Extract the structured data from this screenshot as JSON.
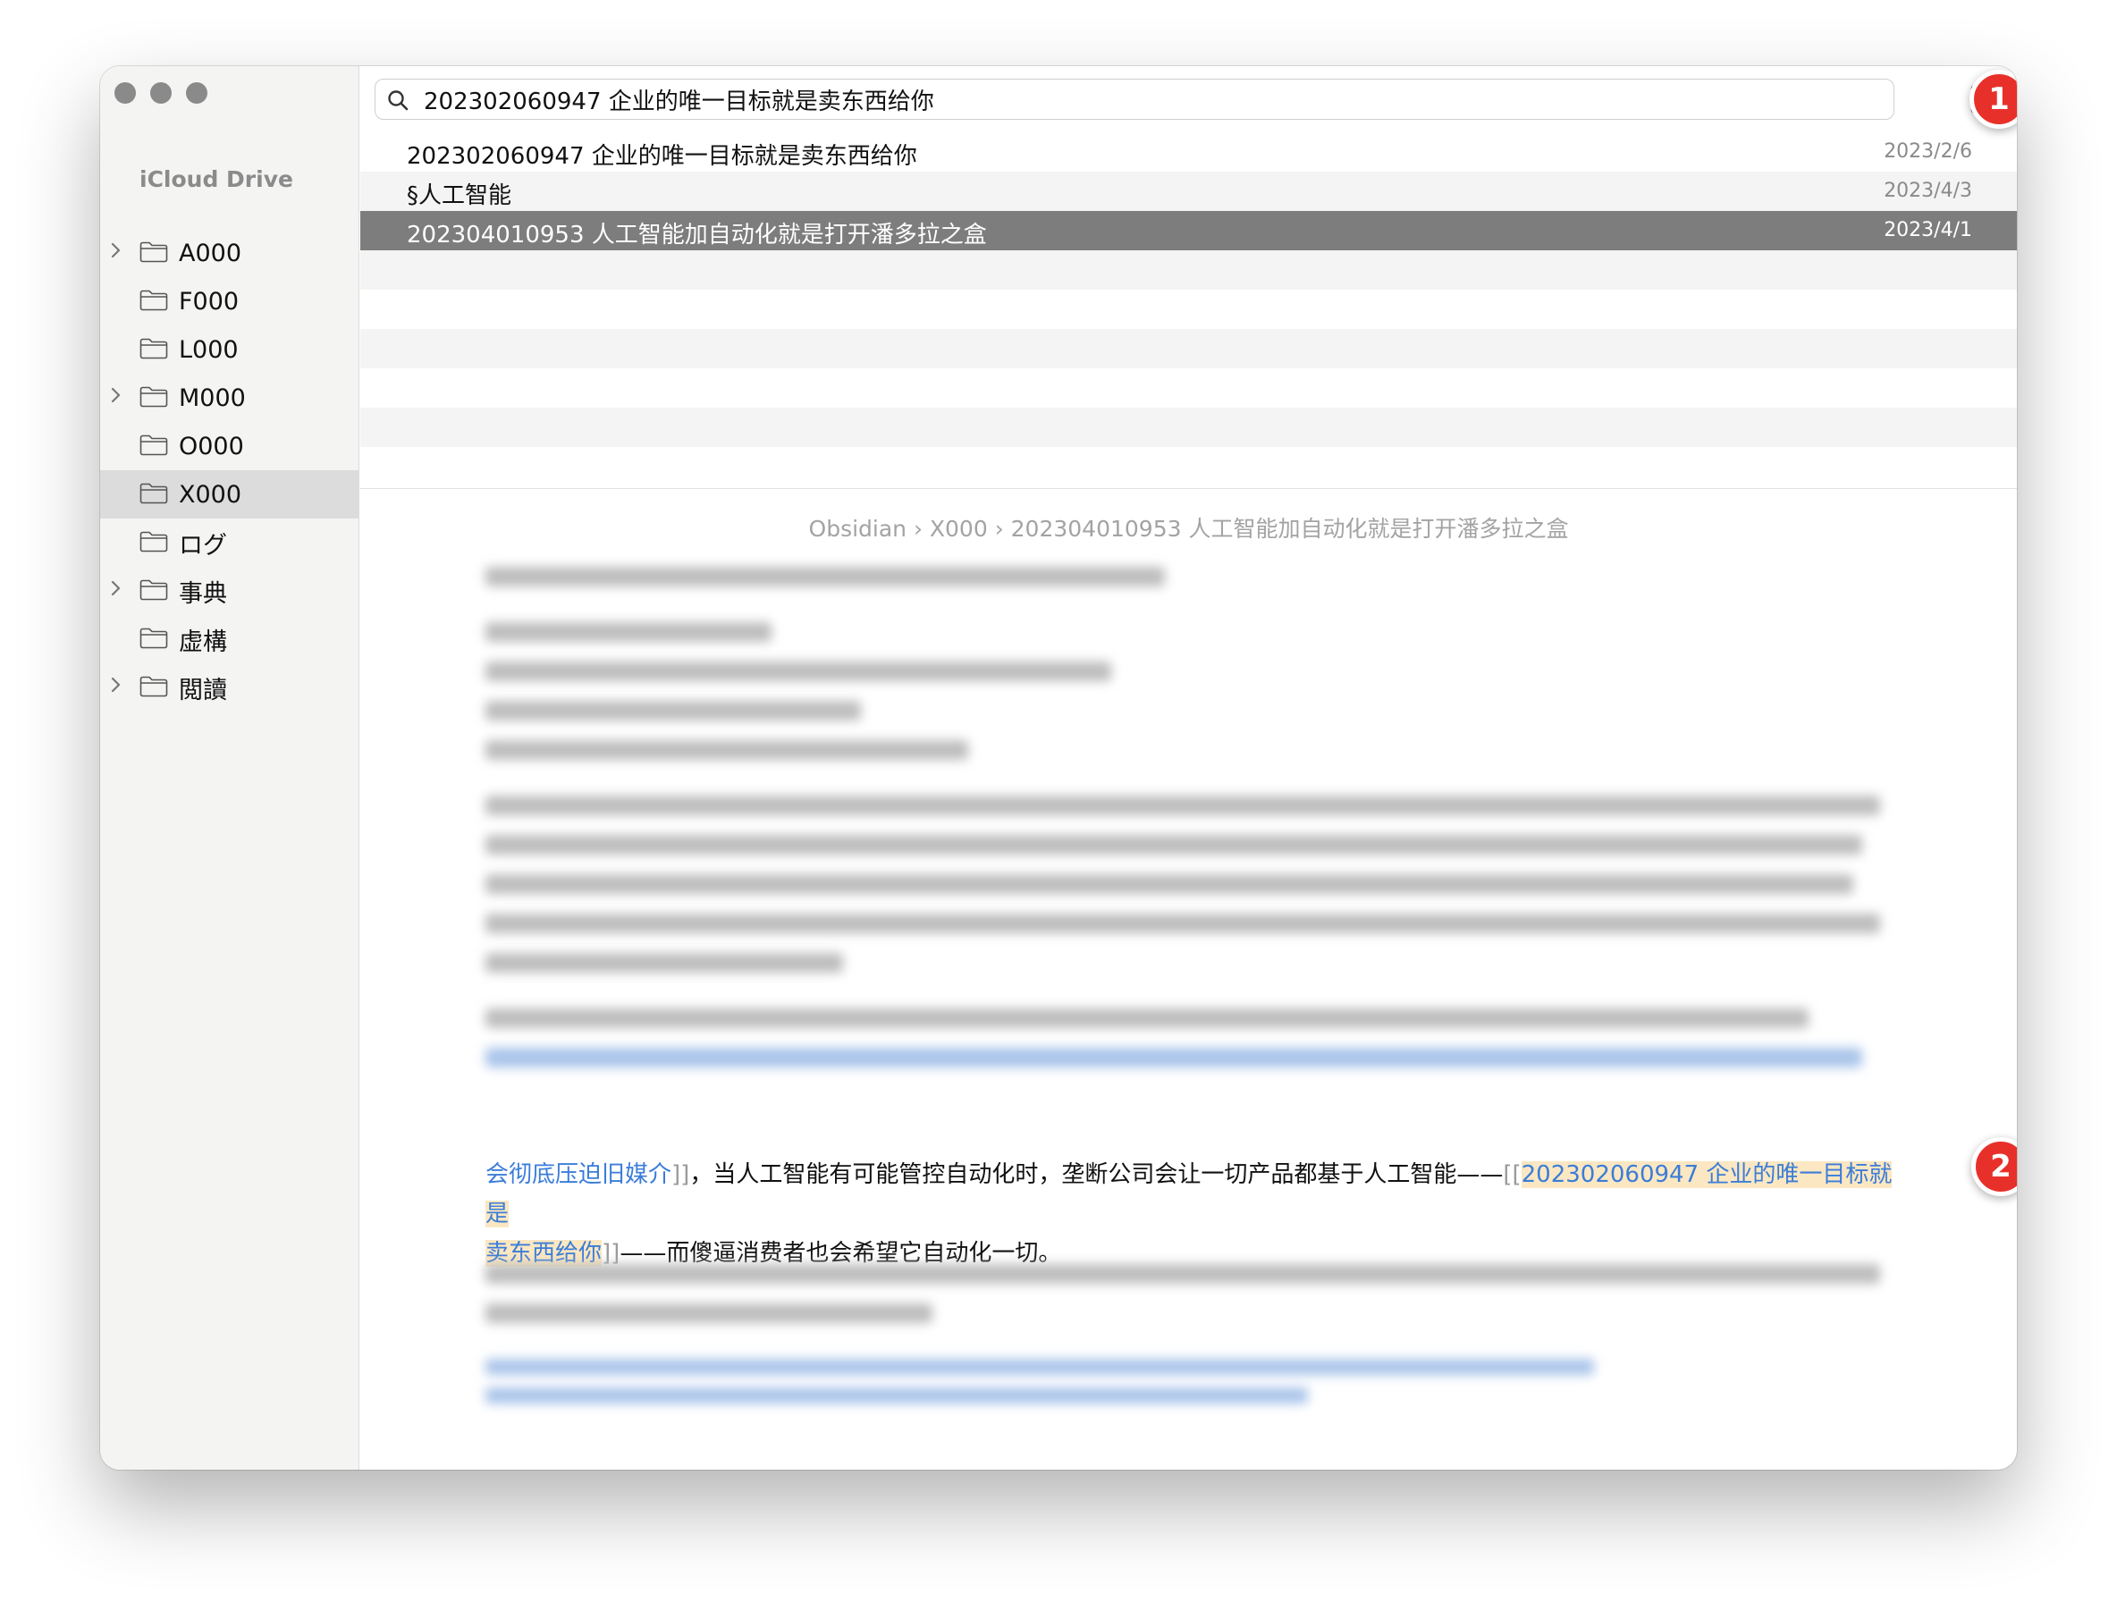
{
  "window": {
    "traffic_lights": [
      "close",
      "minimize",
      "zoom"
    ]
  },
  "sidebar": {
    "title": "iCloud Drive",
    "items": [
      {
        "label": "A000",
        "has_children": true,
        "selected": false
      },
      {
        "label": "F000",
        "has_children": false,
        "selected": false
      },
      {
        "label": "L000",
        "has_children": false,
        "selected": false
      },
      {
        "label": "M000",
        "has_children": true,
        "selected": false
      },
      {
        "label": "O000",
        "has_children": false,
        "selected": false
      },
      {
        "label": "X000",
        "has_children": false,
        "selected": true
      },
      {
        "label": "ログ",
        "has_children": false,
        "selected": false
      },
      {
        "label": "事典",
        "has_children": true,
        "selected": false
      },
      {
        "label": "虚構",
        "has_children": false,
        "selected": false
      },
      {
        "label": "閲讀",
        "has_children": true,
        "selected": false
      }
    ]
  },
  "search": {
    "value": "202302060947 企业的唯一目标就是卖东西给你",
    "icon": "search-icon"
  },
  "toolbar": {
    "compose_icon": "compose-icon"
  },
  "badges": {
    "one": "1",
    "two": "2"
  },
  "results": [
    {
      "title": "202302060947 企业的唯一目标就是卖东西给你",
      "date": "2023/2/6"
    },
    {
      "title": "§人工智能",
      "date": "2023/4/3"
    },
    {
      "title": "202304010953 人工智能加自动化就是打开潘多拉之盒",
      "date": "2023/4/1"
    }
  ],
  "breadcrumb": "Obsidian › X000 › 202304010953 人工智能加自动化就是打开潘多拉之盒",
  "note": {
    "link_tail": "会彻底压迫旧媒介",
    "bracket_close": "]]",
    "text_mid": "，当人工智能有可能管控自动化时，垄断公司会让一切产品都基于人工智能——",
    "bracket_open": "[[",
    "link_main_1": "202302060947 企业的唯一目标就是",
    "link_main_2": "卖东西给你",
    "text_end": "——而傻逼消费者也会希望它自动化一切。"
  },
  "colors": {
    "accent_link": "#3b7dd8",
    "highlight": "#fbe7c2",
    "badge": "#e8302a",
    "selected_row": "#7d7d7d"
  }
}
